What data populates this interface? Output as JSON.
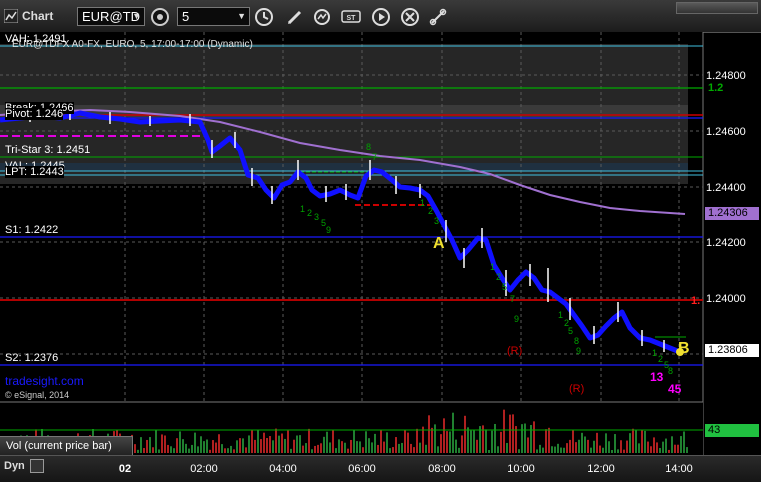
{
  "toolbar": {
    "chart_label": "Chart",
    "symbol_value": "EUR@TD",
    "interval_value": "5",
    "icons": [
      "chart-icon",
      "symbol-options-icon",
      "refresh-icon",
      "clock-icon",
      "pencil-icon",
      "cycle-icon",
      "study-icon",
      "play-icon",
      "close-icon",
      "link-icon"
    ]
  },
  "chart": {
    "header": "EUR@TDFX A0-FX, EURO, 5, 17:00-17:00 (Dynamic)",
    "watermark": "tradesight.com",
    "copyright": "© eSignal, 2014",
    "levels": {
      "vah": "VAH: 1.2491",
      "pivot": "Pivot: 1.246",
      "pbreak": "Break: 1.2466",
      "tristar": "Tri-Star 3: 1.2451",
      "val": "VAL: 1.2445",
      "lpt": "LPT: 1.2443",
      "s1": "S1: 1.2422",
      "s2": "S2: 1.2376"
    },
    "price_axis": [
      "1.24800",
      "1.24600",
      "1.24400",
      "1.24200",
      "1.24000"
    ],
    "price_badges": {
      "sma": "1.24306",
      "last": "1.23806",
      "edge_a": "1.2",
      "edge_b": "1."
    },
    "annotations": {
      "point_a": "A",
      "point_b": "B",
      "r1": "(R)",
      "r2": "(R)",
      "count_13": "13",
      "count_45": "45"
    },
    "time_axis": [
      "02",
      "02:00",
      "04:00",
      "06:00",
      "08:00",
      "10:00",
      "12:00",
      "14:00"
    ],
    "volume_label": "Vol (current price bar)",
    "volume_value": "43",
    "bottom_label": "Dyn",
    "colors": {
      "background": "#000000",
      "candle": "#1010ff",
      "candle_body": "#ffffff",
      "sma": "#a070d0",
      "pivot_red": "#cc0000",
      "support_blue": "#1a1aff",
      "level_green": "#00aa00",
      "val_cyan": "#40c0e0",
      "highlight_yellow": "#f0e030"
    }
  }
}
